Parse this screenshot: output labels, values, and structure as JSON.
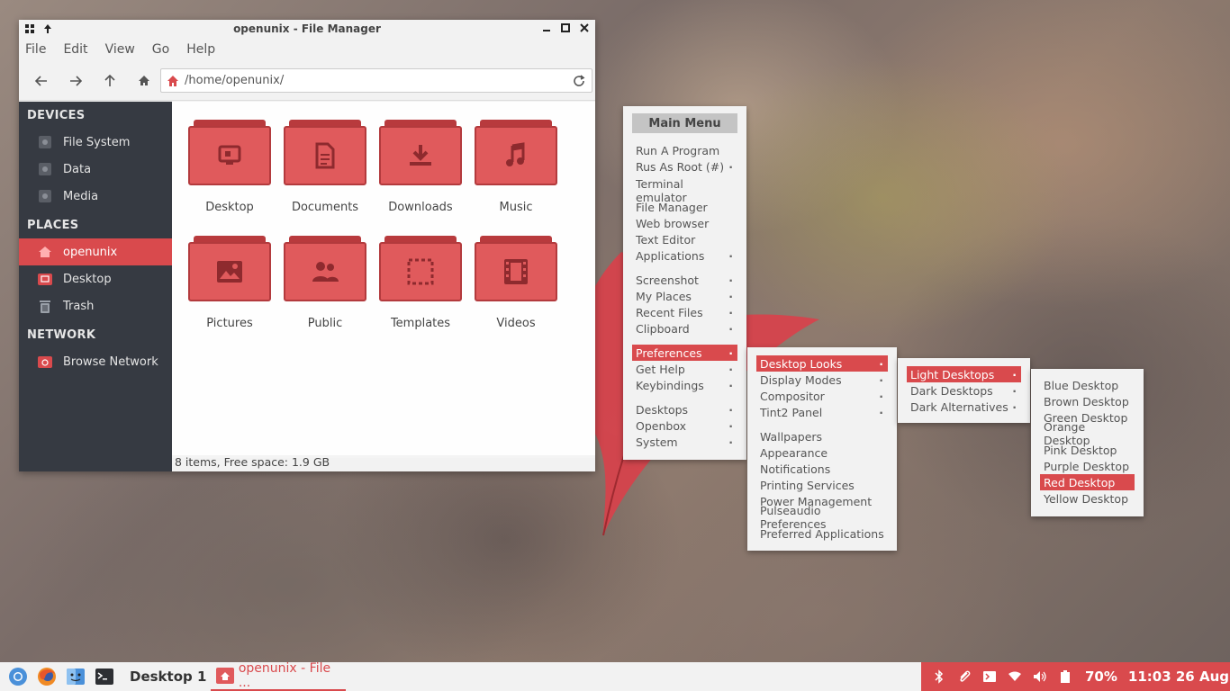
{
  "window": {
    "title": "openunix - File Manager",
    "menu": [
      "File",
      "Edit",
      "View",
      "Go",
      "Help"
    ],
    "address": "/home/openunix/"
  },
  "sidebar": {
    "sections": [
      {
        "label": "DEVICES",
        "items": [
          "File System",
          "Data",
          "Media"
        ]
      },
      {
        "label": "PLACES",
        "items": [
          "openunix",
          "Desktop",
          "Trash"
        ]
      },
      {
        "label": "NETWORK",
        "items": [
          "Browse Network"
        ]
      }
    ],
    "active": "openunix"
  },
  "folders": [
    {
      "name": "Desktop",
      "icon": "monitor-icon"
    },
    {
      "name": "Documents",
      "icon": "document-icon"
    },
    {
      "name": "Downloads",
      "icon": "download-icon"
    },
    {
      "name": "Music",
      "icon": "music-note-icon"
    },
    {
      "name": "Pictures",
      "icon": "image-icon"
    },
    {
      "name": "Public",
      "icon": "people-icon"
    },
    {
      "name": "Templates",
      "icon": "template-icon"
    },
    {
      "name": "Videos",
      "icon": "film-icon"
    }
  ],
  "status": "8 items, Free space: 1.9 GB",
  "main_menu": {
    "title": "Main Menu",
    "groups": [
      [
        "Run A Program",
        "Rus As Root (#)"
      ],
      [
        "Terminal emulator",
        "File Manager",
        "Web browser",
        "Text Editor",
        "Applications"
      ],
      [
        "Screenshot",
        "My Places",
        "Recent Files",
        "Clipboard"
      ],
      [
        "Preferences",
        "Get Help",
        "Keybindings"
      ],
      [
        "Desktops",
        "Openbox",
        "System"
      ]
    ]
  },
  "preferences_menu": {
    "groups": [
      [
        "Desktop Looks",
        "Display Modes",
        "Compositor",
        "Tint2 Panel"
      ],
      [
        "Wallpapers",
        "Appearance",
        "Notifications",
        "Printing Services",
        "Power Management",
        "Pulseaudio Preferences",
        "Preferred Applications"
      ]
    ]
  },
  "looks_menu": {
    "items": [
      "Light Desktops",
      "Dark Desktops",
      "Dark Alternatives"
    ]
  },
  "light_menu": {
    "items": [
      "Blue Desktop",
      "Brown Desktop",
      "Green Desktop",
      "Orange Desktop",
      "Pink Desktop",
      "Purple Desktop",
      "Red Desktop",
      "Yellow Desktop"
    ],
    "selected": "Red Desktop"
  },
  "taskbar": {
    "desktop_label": "Desktop 1",
    "task_label": "openunix - File ...",
    "battery": "70%",
    "clock": "11:03 26 Aug"
  },
  "colors": {
    "accent": "#d94a4d",
    "sidebar_bg": "#363a42",
    "menu_bg": "#f2f2f2"
  }
}
